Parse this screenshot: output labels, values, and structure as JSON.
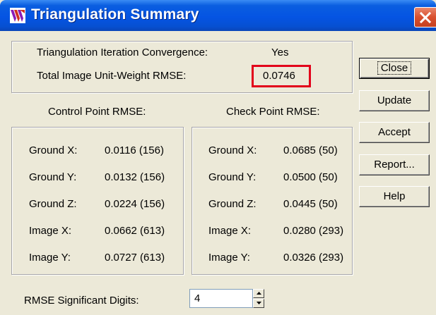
{
  "window": {
    "title": "Triangulation Summary"
  },
  "summary": {
    "convergence_label": "Triangulation Iteration Convergence:",
    "convergence_value": "Yes",
    "rmse_label": "Total Image Unit-Weight RMSE:",
    "rmse_value": "0.0746"
  },
  "control": {
    "heading": "Control Point RMSE:",
    "rows": [
      {
        "label": "Ground X:",
        "value": "0.0116 (156)"
      },
      {
        "label": "Ground Y:",
        "value": "0.0132 (156)"
      },
      {
        "label": "Ground Z:",
        "value": "0.0224 (156)"
      },
      {
        "label": "Image X:",
        "value": "0.0662 (613)"
      },
      {
        "label": "Image Y:",
        "value": "0.0727 (613)"
      }
    ]
  },
  "check": {
    "heading": "Check Point RMSE:",
    "rows": [
      {
        "label": "Ground X:",
        "value": "0.0685 (50)"
      },
      {
        "label": "Ground Y:",
        "value": "0.0500 (50)"
      },
      {
        "label": "Ground Z:",
        "value": "0.0445 (50)"
      },
      {
        "label": "Image X:",
        "value": "0.0280 (293)"
      },
      {
        "label": "Image Y:",
        "value": "0.0326 (293)"
      }
    ]
  },
  "buttons": {
    "close": "Close",
    "update": "Update",
    "accept": "Accept",
    "report": "Report...",
    "help": "Help"
  },
  "digits": {
    "label": "RMSE Significant Digits:",
    "value": "4"
  },
  "colors": {
    "highlight": "#e2001a",
    "titlebar": "#0554e3"
  }
}
